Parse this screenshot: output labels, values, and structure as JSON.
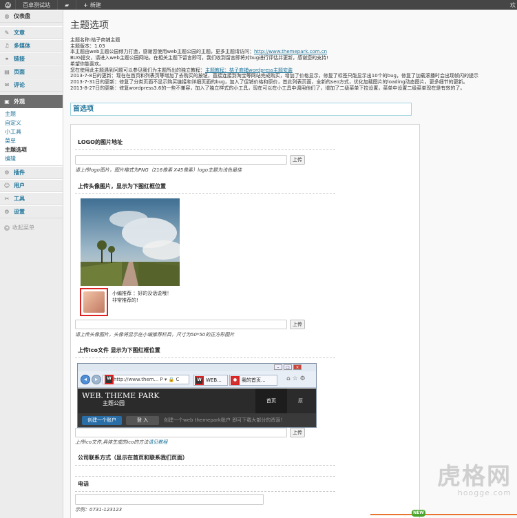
{
  "adminbar": {
    "site_name": "百卓测试站",
    "new_label": "新建",
    "right_text": "欢"
  },
  "sidebar": {
    "items": [
      {
        "label": "仪表盘",
        "icon": "dashboard-icon"
      },
      {
        "label": "文章",
        "icon": "pin-icon"
      },
      {
        "label": "多媒体",
        "icon": "media-icon"
      },
      {
        "label": "链接",
        "icon": "link-icon"
      },
      {
        "label": "页面",
        "icon": "page-icon"
      },
      {
        "label": "评论",
        "icon": "comment-icon"
      },
      {
        "label": "外观",
        "icon": "appearance-icon"
      },
      {
        "label": "插件",
        "icon": "plugin-icon"
      },
      {
        "label": "用户",
        "icon": "users-icon"
      },
      {
        "label": "工具",
        "icon": "tools-icon"
      },
      {
        "label": "设置",
        "icon": "settings-icon"
      }
    ],
    "submenu": [
      "主题",
      "自定义",
      "小工具",
      "菜单",
      "主题选项",
      "编辑"
    ],
    "collapse_label": "收起菜单"
  },
  "page": {
    "title": "主题选项",
    "intro": [
      "主题名称:桔子商铺主题",
      "主题版本：1.03",
      "本主题由web主题公园倾力打造，感谢您使用web主题公园的主题，更多主题请访问：",
      "BUG提交，请进入web主题公园网站，在相关主题下留言即可，我们收到留言即将对bug进行评估并更新，感谢您的支持!",
      "希望你能喜欢。",
      "您在使用此主题遇到问题可以参见我们为主题所出的独立教程：",
      "2013-7-8日的更新：现在在首页和列表页等增加了去购买的按钮，直接连接到淘宝等网站完成购买，增加了价格显示，修复了标签只能显示出10个的bug，修复了加载滚播时会出现帧闪的提示",
      "2013-7-31日的更新：修复了分类页面不显示购买链接和详细页面的bug，加入了促销价格和原价，首此列表页面，全新的seo方式，优化加载图片的loading动态图片，更多细节的更新。",
      "2013-8-27日的更新：修复wordpress3.6的一些不兼容，加入了独立样式的小工具，现在可以在小工具中调用他们了，增加了二级菜单下拉设置，菜单中设置二级菜单现在是有效的了。"
    ],
    "intro_link": "http://www.themepark.com.cn",
    "tutorial_link": "主题教程：桔子商铺wordpress主题安装"
  },
  "options": {
    "section_title": "首选项",
    "logo_label": "LOGO的图片地址",
    "logo_hint": "请上传logo图片，图片格式为PNG（216像素 X45像素）logo主题为浅色最佳",
    "avatar_label": "上传头像图片，显示为下图红框位置",
    "avatar_caption_1": "小编推荐 ：好的没话说哦！",
    "avatar_caption_2": "非常推荐的!",
    "avatar_hint": "请上传头像图片，头像将显示在小编推荐栏目，尺寸为50*50的正方形图片",
    "ico_label": "上传ico文件 显示为下图红框位置",
    "ico_hint": "上传ico文件,具体生成的ico的方法",
    "ico_hint_link": "请见教程",
    "company_label": "公司联系方式（显示在首页和联系我们页面）",
    "phone_label": "电话",
    "phone_hint": "示例：0731-123123",
    "upload_label": "上传"
  },
  "browser_preview": {
    "address": "http://www.them...",
    "address_icons": "P ▾ 🔒 C",
    "tab1": "WEB...",
    "tab2": "我的首页...",
    "ico_text": "W",
    "logo_main": "THEME PARK",
    "logo_sub": "主题公园",
    "logo_web": "WEB.",
    "nav_home": "首页",
    "nav_more": "原",
    "btn_create": "创建一个账户",
    "btn_login": "登  入",
    "promo": "创建一个web themepark账户 即可下载大部分的资源！"
  },
  "watermark": {
    "main": "虎格网",
    "sub": "hoogge.com"
  },
  "colors": {
    "link": "#21759b",
    "adminbar": "#464646",
    "current_menu": "#6d6d6d",
    "highlight_red": "#dd2222"
  }
}
